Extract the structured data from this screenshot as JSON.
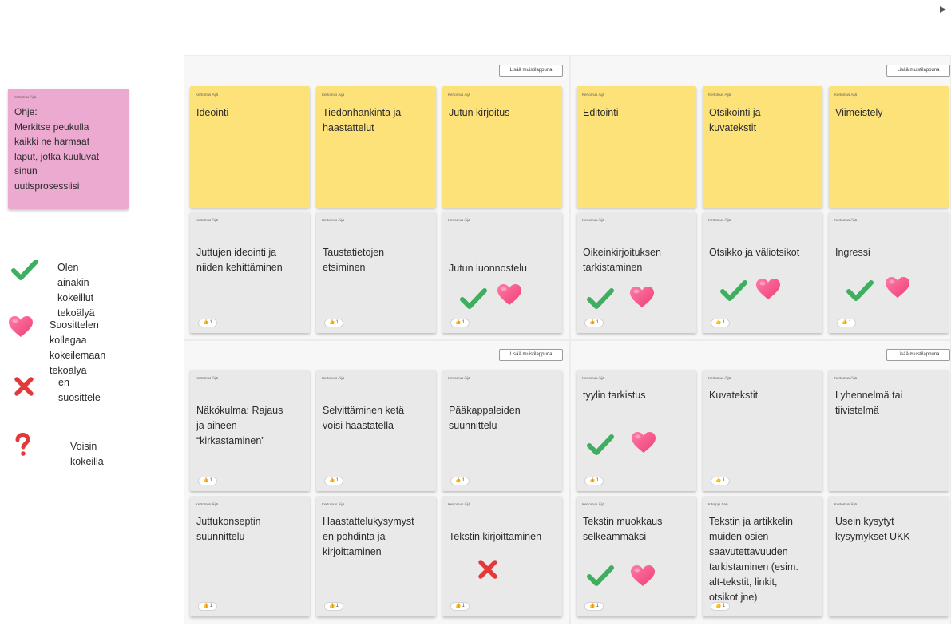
{
  "colors": {
    "yellow_note": "#fde27a",
    "grey_note": "#e9e9e9",
    "pink_note": "#ecaad1",
    "check": "#3fae60",
    "heart": "#ee3e74",
    "cross": "#e23a3a",
    "question": "#e23a3a"
  },
  "sections": [
    {
      "button_label": "Lisää muistilappuna"
    },
    {
      "button_label": "Lisää muistilappuna"
    },
    {
      "button_label": "Lisää muistilappuna"
    },
    {
      "button_label": "Lisää muistilappuna"
    }
  ],
  "instruction": {
    "author": "Kertomus Äijä",
    "text": "Ohje:\nMerkitse peukulla\nkaikki ne harmaat\nlaput, jotka kuuluvat\nsinun\nuutisprosessiisi"
  },
  "legend": [
    {
      "icon": "check-icon",
      "label": "Olen ainakin kokeillut\ntekoälyä"
    },
    {
      "icon": "heart-icon",
      "label": "Suosittelen kollegaa\nkokeilemaan tekoälyä"
    },
    {
      "icon": "cross-icon",
      "label": "en suosittele"
    },
    {
      "icon": "question-icon",
      "label": "Voisin kokeilla"
    }
  ],
  "phases": [
    {
      "author": "Kertomus Äijä",
      "label": "Ideointi"
    },
    {
      "author": "Kertomus Äijä",
      "label": "Tiedonhankinta ja\nhaastattelut"
    },
    {
      "author": "Kertomus Äijä",
      "label": "Jutun kirjoitus"
    },
    {
      "author": "Kertomus Äijä",
      "label": "Editointi"
    },
    {
      "author": "Kertomus Äijä",
      "label": "Otsikointi ja\nkuvatekstit"
    },
    {
      "author": "Kertomus Äijä",
      "label": "Viimeistely"
    }
  ],
  "tasks": [
    {
      "author": "Kertomus Äijä",
      "label": "Juttujen ideointi ja\nniiden kehittäminen",
      "votes": "1",
      "marks": []
    },
    {
      "author": "Kertomus Äijä",
      "label": "Taustatietojen\netsiminen",
      "votes": "1",
      "marks": []
    },
    {
      "author": "Kertomus Äijä",
      "label": "Jutun luonnostelu",
      "votes": "1",
      "marks": [
        "check-icon",
        "heart-icon"
      ]
    },
    {
      "author": "Kertomus Äijä",
      "label": "Oikeinkirjoituksen\ntarkistaminen",
      "votes": "1",
      "marks": [
        "check-icon",
        "heart-icon"
      ]
    },
    {
      "author": "Kertomus Äijä",
      "label": "Otsikko ja väliotsikot",
      "votes": "1",
      "marks": [
        "check-icon",
        "heart-icon"
      ]
    },
    {
      "author": "Kertomus Äijä",
      "label": "Ingressi",
      "votes": "1",
      "marks": [
        "check-icon",
        "heart-icon"
      ]
    },
    {
      "author": "Kertomus Äijä",
      "label": "Näkökulma: Rajaus\nja aiheen\n“kirkastaminen”",
      "votes": "1",
      "marks": []
    },
    {
      "author": "Kertomus Äijä",
      "label": "Selvittäminen ketä\nvoisi haastatella",
      "votes": "1",
      "marks": []
    },
    {
      "author": "Kertomus Äijä",
      "label": "Pääkappaleiden\nsuunnittelu",
      "votes": "1",
      "marks": []
    },
    {
      "author": "Kertomus Äijä",
      "label": "tyylin tarkistus",
      "votes": "1",
      "marks": [
        "check-icon",
        "heart-icon"
      ]
    },
    {
      "author": "Kertomus Äijä",
      "label": "Kuvatekstit",
      "votes": "1",
      "marks": []
    },
    {
      "author": "Kertomus Äijä",
      "label": "Lyhennelmä tai\ntiivistelmä",
      "votes": "",
      "marks": []
    },
    {
      "author": "Kertomus Äijä",
      "label": "Juttukonseptin\nsuunnittelu",
      "votes": "1",
      "marks": []
    },
    {
      "author": "Kertomus Äijä",
      "label": "Haastattelukysymyst\nen pohdinta ja\nkirjoittaminen",
      "votes": "1",
      "marks": []
    },
    {
      "author": "Kertomus Äijä",
      "label": "Tekstin kirjoittaminen",
      "votes": "1",
      "marks": [
        "cross-icon"
      ]
    },
    {
      "author": "Kertomus Äijä",
      "label": "Tekstin muokkaus\nselkeämmäksi",
      "votes": "1",
      "marks": [
        "check-icon",
        "heart-icon"
      ]
    },
    {
      "author": "Kämppi Sari",
      "label": "Tekstin ja artikkelin\nmuiden osien\nsaavutettavuuden\ntarkistaminen (esim.\nalt-tekstit, linkit,\notsikot jne)",
      "votes": "1",
      "marks": []
    },
    {
      "author": "Kertomus Äijä",
      "label": "Usein kysytyt\nkysymykset UKK",
      "votes": "",
      "marks": []
    }
  ]
}
